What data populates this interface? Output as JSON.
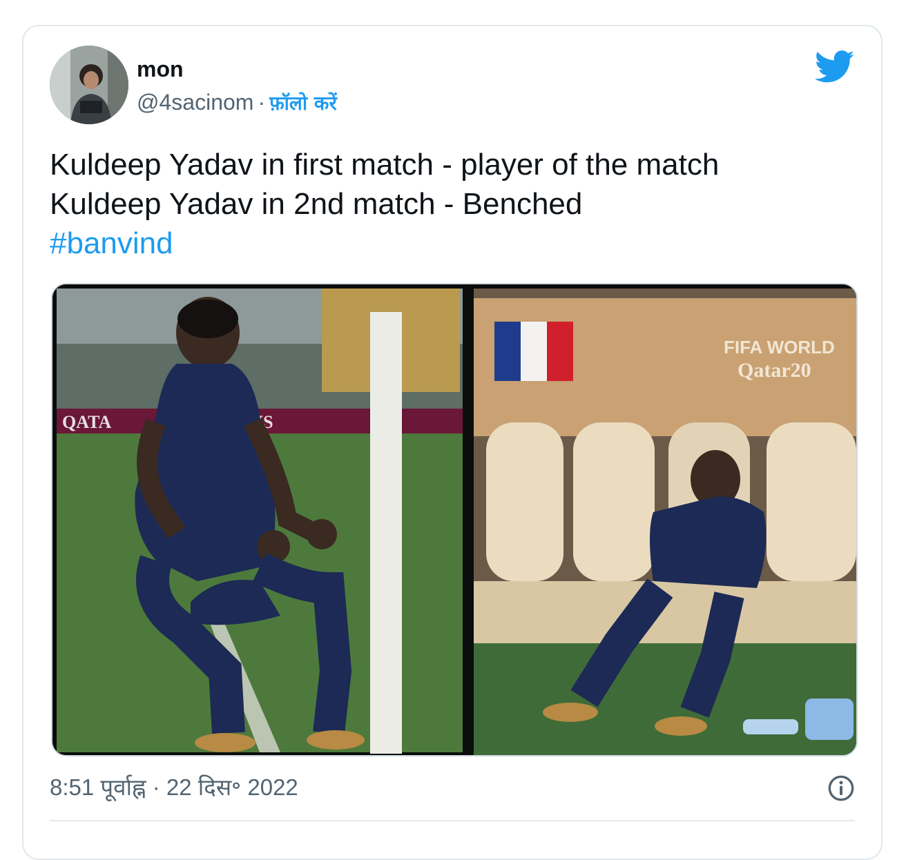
{
  "tweet": {
    "author_name": "mon",
    "author_handle": "@4sacinom",
    "separator": "·",
    "follow_label": "फ़ॉलो करें",
    "text_lines": [
      "Kuldeep Yadav in first match - player of the match",
      "Kuldeep Yadav in 2nd match - Benched"
    ],
    "hashtag": "#banvind",
    "timestamp": "8:51 पूर्वाह्न · 22 दिस॰ 2022",
    "icons": {
      "brand": "twitter-bird-icon",
      "info": "info-icon"
    },
    "media": {
      "right_panel_banner_line1": "FIFA WORLD",
      "right_panel_banner_line2": "Qatar20",
      "left_panel_board_text": "QATA",
      "left_panel_board_text2": "AYS"
    }
  },
  "colors": {
    "link_blue": "#1d9bf0",
    "text_primary": "#0f1419",
    "text_secondary": "#536471",
    "border": "#e1e8ed"
  }
}
